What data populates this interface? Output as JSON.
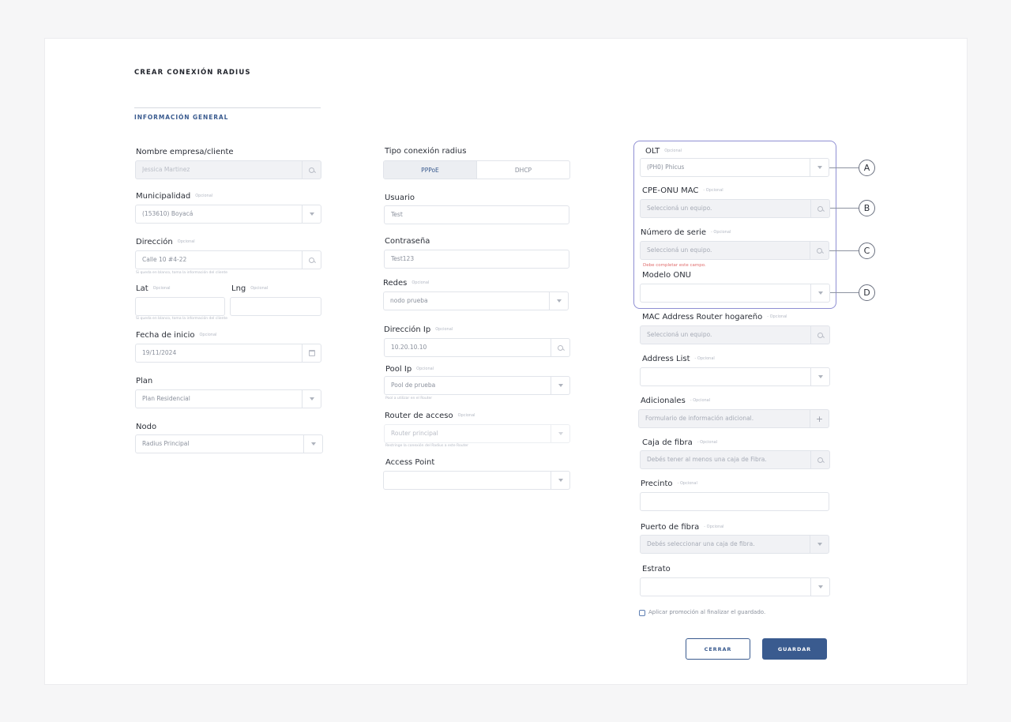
{
  "form": {
    "title": "CREAR CONEXIÓN RADIUS",
    "section_title": "INFORMACIÓN GENERAL",
    "optional_tag": "Opcional",
    "optional_tag_dash": "- Opcional"
  },
  "left": {
    "cliente_label": "Nombre empresa/cliente",
    "cliente_value": "Jessica Martinez",
    "municipalidad_label": "Municipalidad",
    "municipalidad_value": "(153610) Boyacá",
    "direccion_label": "Dirección",
    "direccion_value": "Calle 10 #4-22",
    "direccion_hint": "Si queda en blanco, toma la información del cliente",
    "lat_label": "Lat",
    "lng_label": "Lng",
    "latlng_hint": "Si queda en blanco, toma la información del cliente",
    "fecha_label": "Fecha de inicio",
    "fecha_value": "19/11/2024",
    "plan_label": "Plan",
    "plan_value": "Plan Residencial",
    "nodo_label": "Nodo",
    "nodo_value": "Radius Principal"
  },
  "middle": {
    "tipo_label": "Tipo conexión radius",
    "tipo_options": [
      "PPPoE",
      "DHCP"
    ],
    "usuario_label": "Usuario",
    "usuario_value": "Test",
    "contrasena_label": "Contraseña",
    "contrasena_value": "Test123",
    "redes_label": "Redes",
    "redes_value": "nodo prueba",
    "ip_label": "Dirección Ip",
    "ip_value": "10.20.10.10",
    "pool_label": "Pool Ip",
    "pool_value": "Pool de prueba",
    "pool_hint": "Pool a utilizar en el Router",
    "router_label": "Router de acceso",
    "router_value": "Router principal",
    "router_hint": "Restringe la conexión del Radius a este Router",
    "ap_label": "Access Point",
    "ap_value": ""
  },
  "right": {
    "olt_label": "OLT",
    "olt_value": "(PH0) Phicus",
    "cpe_label": "CPE-ONU MAC",
    "cpe_placeholder": "Seleccioná un equipo.",
    "serie_label": "Número de serie",
    "serie_placeholder": "Seleccioná un equipo.",
    "serie_error": "Debe completar este campo.",
    "modelo_label": "Modelo ONU",
    "modelo_value": "",
    "mac_label": "MAC Address Router hogareño",
    "mac_placeholder": "Seleccioná un equipo.",
    "address_label": "Address List",
    "address_value": "",
    "adicionales_label": "Adicionales",
    "adicionales_placeholder": "Formulario de información adicional.",
    "caja_label": "Caja de fibra",
    "caja_placeholder": "Debés tener al menos una caja de Fibra.",
    "precinto_label": "Precinto",
    "precinto_value": "",
    "puerto_label": "Puerto de fibra",
    "puerto_placeholder": "Debés seleccionar una caja de fibra.",
    "estrato_label": "Estrato",
    "estrato_value": "",
    "promo_label": "Aplicar promoción al finalizar el guardado."
  },
  "callouts": [
    "A",
    "B",
    "C",
    "D"
  ],
  "actions": {
    "close_label": "CERRAR",
    "save_label": "GUARDAR"
  },
  "colors": {
    "accent": "#3a5b8f",
    "highlight": "#8f8fd3",
    "error": "#e06c6c"
  },
  "icons": {
    "dropdown": "chevron-down-icon",
    "lookup": "search-icon",
    "date": "calendar-icon",
    "add": "plus-icon"
  }
}
